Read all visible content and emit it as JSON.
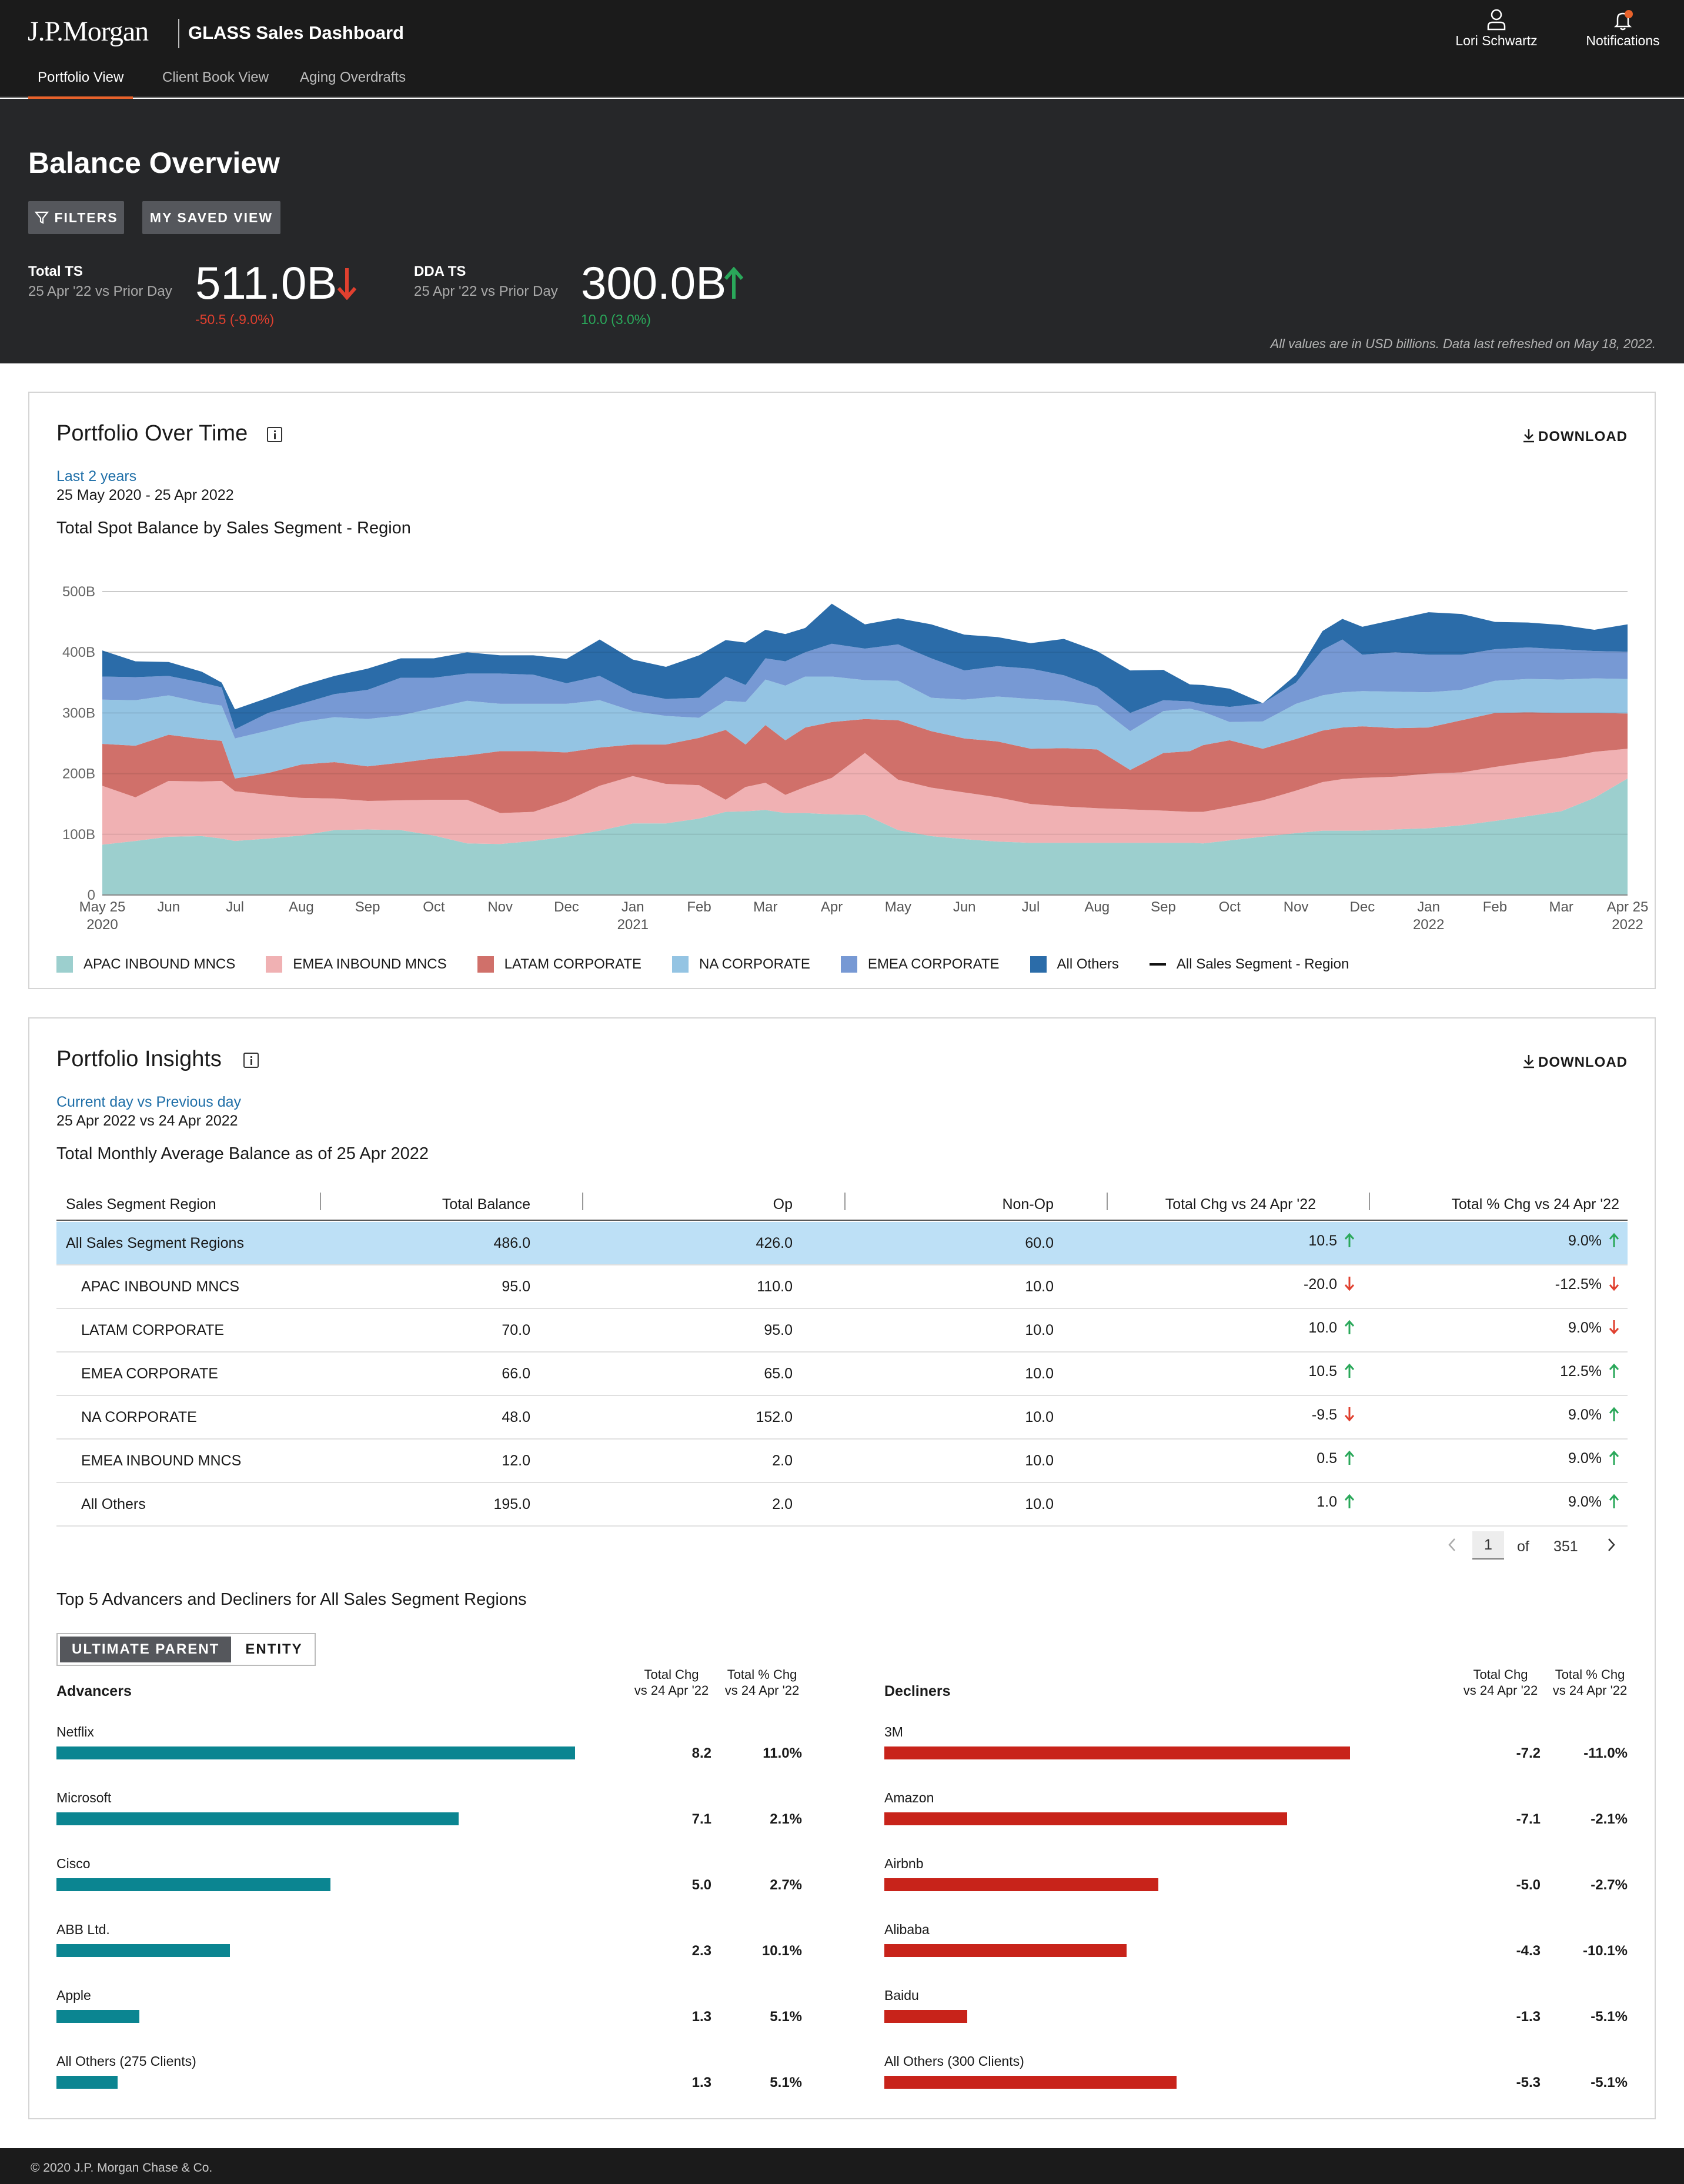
{
  "header": {
    "logo": "J.P.Morgan",
    "app_title": "GLASS Sales Dashboard",
    "user_name": "Lori Schwartz",
    "notifications_label": "Notifications",
    "tabs": [
      {
        "label": "Portfolio View",
        "active": true
      },
      {
        "label": "Client Book View",
        "active": false
      },
      {
        "label": "Aging Overdrafts",
        "active": false
      }
    ]
  },
  "hero": {
    "title": "Balance Overview",
    "filters_label": "FILTERS",
    "saved_view_label": "MY SAVED VIEW",
    "kpis": [
      {
        "label": "Total TS",
        "sub": "25 Apr '22 vs Prior Day",
        "value": "511.0B",
        "change": "-50.5 (-9.0%)",
        "direction": "down"
      },
      {
        "label": "DDA TS",
        "sub": "25 Apr '22 vs Prior Day",
        "value": "300.0B",
        "change": "10.0 (3.0%)",
        "direction": "up"
      }
    ],
    "note": "All values are in USD billions.   Data last refreshed on May 18, 2022."
  },
  "portfolio_over_time": {
    "title": "Portfolio Over Time",
    "download_label": "DOWNLOAD",
    "period_link": "Last 2 years",
    "date_range": "25 May 2020 - 25 Apr 2022",
    "chart_title": "Total Spot Balance by Sales Segment - Region"
  },
  "chart_data": {
    "type": "area",
    "stacked": true,
    "title": "Total Spot Balance by Sales Segment - Region",
    "y_ticks": [
      "0",
      "100B",
      "200B",
      "300B",
      "400B",
      "500B"
    ],
    "ylim": [
      0,
      500
    ],
    "x_labels": [
      "May 25\n2020",
      "Jun",
      "Jul",
      "Aug",
      "Sep",
      "Oct",
      "Nov",
      "Dec",
      "Jan\n2021",
      "Feb",
      "Mar",
      "Apr",
      "May",
      "Jun",
      "Jul",
      "Aug",
      "Sep",
      "Oct",
      "Nov",
      "Dec",
      "Jan\n2022",
      "Feb",
      "Mar",
      "Apr 25\n2022"
    ],
    "grid": true,
    "legend_position": "bottom-left",
    "x": [
      0,
      0.5,
      1,
      1.5,
      1.8,
      2,
      2.5,
      3,
      3.5,
      4,
      4.5,
      5,
      5.5,
      6,
      6.5,
      7,
      7.5,
      8,
      8.5,
      9,
      9.4,
      9.7,
      10,
      10.3,
      10.6,
      11,
      11.5,
      12,
      12.5,
      13,
      13.5,
      14,
      14.5,
      15,
      15.5,
      16,
      16.4,
      16.6,
      17,
      17.5,
      18,
      18.4,
      18.7,
      19,
      19.5,
      20,
      20.5,
      21,
      21.5,
      22,
      22.5,
      23
    ],
    "series": [
      {
        "name": "APAC INBOUND MNCS",
        "color": "#9ccfce",
        "values": [
          83,
          89,
          96,
          97,
          93,
          89,
          93,
          98,
          107,
          108,
          107,
          98,
          85,
          84,
          89,
          96,
          106,
          118,
          118,
          126,
          137,
          138,
          140,
          135,
          135,
          133,
          132,
          107,
          97,
          92,
          88,
          86,
          86,
          86,
          86,
          86,
          86,
          85,
          90,
          96,
          102,
          106,
          106,
          106,
          108,
          110,
          115,
          122,
          130,
          138,
          160,
          192
        ]
      },
      {
        "name": "EMEA INBOUND MNCS",
        "color": "#f0b1b3",
        "values": [
          97,
          72,
          92,
          90,
          95,
          82,
          72,
          62,
          52,
          47,
          49,
          59,
          72,
          51,
          48,
          59,
          74,
          78,
          65,
          55,
          20,
          40,
          45,
          30,
          43,
          60,
          102,
          83,
          80,
          77,
          73,
          64,
          60,
          57,
          55,
          53,
          51,
          52,
          55,
          60,
          70,
          80,
          85,
          87,
          87,
          90,
          87,
          89,
          89,
          88,
          76,
          49
        ]
      },
      {
        "name": "LATAM CORPORATE",
        "color": "#d0706a",
        "values": [
          69,
          85,
          76,
          70,
          66,
          21,
          36,
          55,
          60,
          57,
          62,
          68,
          73,
          102,
          100,
          80,
          63,
          52,
          65,
          78,
          115,
          70,
          95,
          90,
          98,
          92,
          56,
          98,
          93,
          89,
          92,
          91,
          96,
          97,
          65,
          95,
          100,
          110,
          110,
          85,
          85,
          85,
          85,
          85,
          80,
          76,
          86,
          89,
          82,
          74,
          64,
          58
        ]
      },
      {
        "name": "NA CORPORATE",
        "color": "#94c4e3",
        "values": [
          73,
          75,
          65,
          60,
          58,
          66,
          70,
          70,
          74,
          78,
          78,
          83,
          90,
          78,
          78,
          80,
          78,
          55,
          47,
          33,
          48,
          70,
          75,
          90,
          84,
          75,
          64,
          65,
          55,
          64,
          74,
          82,
          78,
          72,
          64,
          69,
          70,
          55,
          30,
          45,
          58,
          58,
          58,
          58,
          60,
          58,
          50,
          53,
          55,
          55,
          57,
          57
        ]
      },
      {
        "name": "EMEA CORPORATE",
        "color": "#7799d4",
        "values": [
          38,
          38,
          32,
          33,
          30,
          15,
          29,
          30,
          38,
          48,
          62,
          50,
          45,
          50,
          48,
          34,
          40,
          30,
          28,
          33,
          40,
          28,
          35,
          40,
          40,
          54,
          52,
          60,
          65,
          48,
          50,
          50,
          42,
          30,
          30,
          18,
          12,
          12,
          25,
          30,
          35,
          75,
          87,
          60,
          65,
          62,
          58,
          52,
          52,
          50,
          45,
          45
        ]
      },
      {
        "name": "All Others",
        "color": "#2b6ca9",
        "values": [
          43,
          26,
          23,
          18,
          8,
          33,
          25,
          30,
          30,
          35,
          32,
          32,
          35,
          30,
          32,
          40,
          60,
          55,
          53,
          70,
          60,
          70,
          47,
          45,
          40,
          66,
          40,
          43,
          56,
          59,
          48,
          42,
          60,
          60,
          70,
          50,
          28,
          32,
          30,
          0,
          13,
          31,
          34,
          46,
          54,
          70,
          67,
          45,
          41,
          40,
          35,
          45
        ]
      },
      {
        "name": "All Sales Segment - Region",
        "color": "#111111",
        "kind": "line"
      }
    ]
  },
  "portfolio_insights": {
    "title": "Portfolio Insights",
    "download_label": "DOWNLOAD",
    "period_link": "Current day vs Previous day",
    "date_range": "25 Apr 2022 vs 24 Apr 2022",
    "table_title": "Total Monthly Average Balance as of 25 Apr 2022",
    "columns": [
      "Sales Segment Region",
      "Total Balance",
      "Op",
      "Non-Op",
      "Total Chg vs 24 Apr '22",
      "Total % Chg vs 24 Apr '22"
    ],
    "rows": [
      {
        "name": "All Sales Segment Regions",
        "total": "486.0",
        "op": "426.0",
        "nonop": "60.0",
        "chg": "10.5",
        "chg_dir": "up",
        "pct": "9.0%",
        "pct_dir": "up",
        "highlight": true
      },
      {
        "name": "APAC INBOUND MNCS",
        "total": "95.0",
        "op": "110.0",
        "nonop": "10.0",
        "chg": "-20.0",
        "chg_dir": "down",
        "pct": "-12.5%",
        "pct_dir": "down"
      },
      {
        "name": "LATAM CORPORATE",
        "total": "70.0",
        "op": "95.0",
        "nonop": "10.0",
        "chg": "10.0",
        "chg_dir": "up",
        "pct": "9.0%",
        "pct_dir": "down"
      },
      {
        "name": "EMEA CORPORATE",
        "total": "66.0",
        "op": "65.0",
        "nonop": "10.0",
        "chg": "10.5",
        "chg_dir": "up",
        "pct": "12.5%",
        "pct_dir": "up"
      },
      {
        "name": "NA CORPORATE",
        "total": "48.0",
        "op": "152.0",
        "nonop": "10.0",
        "chg": "-9.5",
        "chg_dir": "down",
        "pct": "9.0%",
        "pct_dir": "up"
      },
      {
        "name": "EMEA INBOUND MNCS",
        "total": "12.0",
        "op": "2.0",
        "nonop": "10.0",
        "chg": "0.5",
        "chg_dir": "up",
        "pct": "9.0%",
        "pct_dir": "up"
      },
      {
        "name": "All Others",
        "total": "195.0",
        "op": "2.0",
        "nonop": "10.0",
        "chg": "1.0",
        "chg_dir": "up",
        "pct": "9.0%",
        "pct_dir": "up"
      }
    ],
    "pagination": {
      "current": "1",
      "of_label": "of",
      "total": "351"
    },
    "top5_title": "Top 5 Advancers and Decliners for All Sales Segment Regions",
    "toggle": [
      "ULTIMATE PARENT",
      "ENTITY"
    ],
    "advancers_label": "Advancers",
    "decliners_label": "Decliners",
    "chg_col": "Total Chg\nvs 24 Apr '22",
    "pct_col": "Total % Chg\nvs 24 Apr '22",
    "advancers": [
      {
        "name": "Netflix",
        "chg": "8.2",
        "pct": "11.0%",
        "share": 1.0
      },
      {
        "name": "Microsoft",
        "chg": "7.1",
        "pct": "2.1%",
        "share": 0.775
      },
      {
        "name": "Cisco",
        "chg": "5.0",
        "pct": "2.7%",
        "share": 0.528
      },
      {
        "name": "ABB Ltd.",
        "chg": "2.3",
        "pct": "10.1%",
        "share": 0.335
      },
      {
        "name": "Apple",
        "chg": "1.3",
        "pct": "5.1%",
        "share": 0.16
      },
      {
        "name": "All Others (275 Clients)",
        "chg": "1.3",
        "pct": "5.1%",
        "share": 0.118
      }
    ],
    "decliners": [
      {
        "name": "3M",
        "chg": "-7.2",
        "pct": "-11.0%",
        "share": 1.0
      },
      {
        "name": "Amazon",
        "chg": "-7.1",
        "pct": "-2.1%",
        "share": 0.865
      },
      {
        "name": "Airbnb",
        "chg": "-5.0",
        "pct": "-2.7%",
        "share": 0.588
      },
      {
        "name": "Alibaba",
        "chg": "-4.3",
        "pct": "-10.1%",
        "share": 0.52
      },
      {
        "name": "Baidu",
        "chg": "-1.3",
        "pct": "-5.1%",
        "share": 0.178
      },
      {
        "name": "All Others (300 Clients)",
        "chg": "-5.3",
        "pct": "-5.1%",
        "share": 0.628
      }
    ],
    "advancer_color": "#0b8591",
    "decliner_color": "#c8231a"
  },
  "footer": {
    "copyright": "© 2020 J.P. Morgan Chase & Co."
  }
}
